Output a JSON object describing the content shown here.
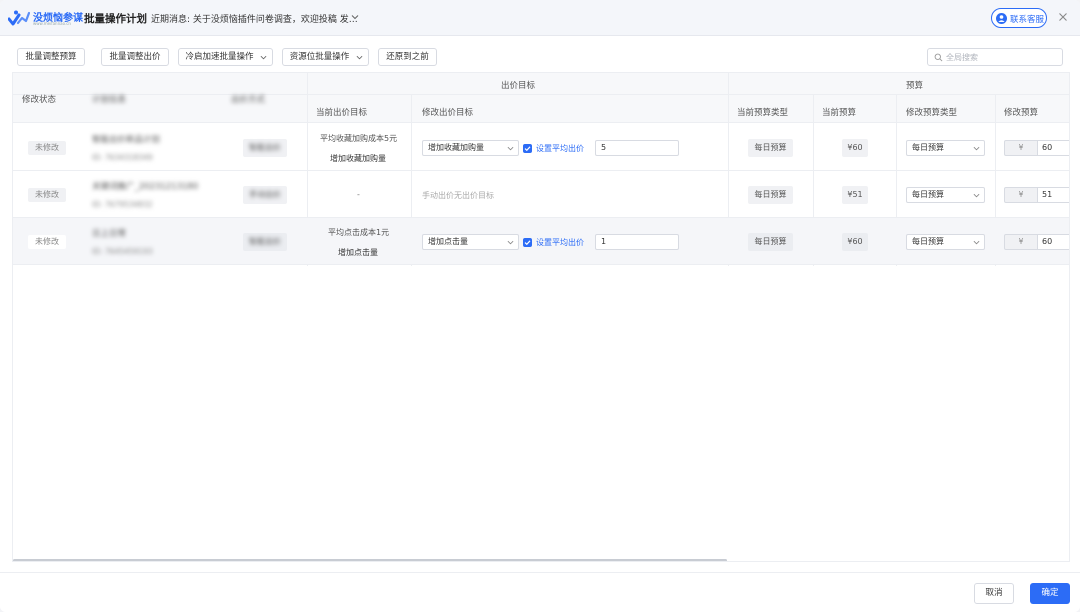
{
  "header": {
    "logo_text": "没烦恼参谋",
    "logo_sub": "www.meifannao.cn",
    "title": "批量操作计划",
    "news": "近期消息: 关于没烦恼插件问卷调查，欢迎投稿 发…",
    "support_label": "联系客服"
  },
  "toolbar": {
    "buttons": [
      "批量调整预算",
      "批量调整出价",
      "冷启加速批量操作",
      "资源位批量操作",
      "还原到之前"
    ],
    "search_placeholder": "全局搜索"
  },
  "table": {
    "group_headers": {
      "bid": "出价目标",
      "budget": "预算"
    },
    "headers": {
      "status": "修改状态",
      "plan": "计划信息",
      "mode": "出价方式",
      "current_bid_target": "当前出价目标",
      "modify_bid_target": "修改出价目标",
      "current_budget_type": "当前预算类型",
      "current_budget": "当前预算",
      "modify_budget_type": "修改预算类型",
      "modify_budget": "修改预算"
    },
    "rows": [
      {
        "status": "未修改",
        "plan_name": "智能出价新品计划",
        "plan_id": "ID: 7634318349",
        "mode": "智能出价",
        "current_target_line1": "平均收藏加购成本5元",
        "current_target_line2": "增加收藏加购量",
        "modify_select": "增加收藏加购量",
        "checkbox_label": "设置平均出价",
        "bid_value": "5",
        "current_budget_type": "每日预算",
        "current_budget": "¥60",
        "modify_budget_type": "每日预算",
        "yen": "¥",
        "budget_value": "60"
      },
      {
        "status": "未修改",
        "plan_name": "关键词推广_20231213180",
        "plan_id": "ID: 7679534832",
        "mode": "手动出价",
        "current_target_line1": "-",
        "manual_note": "手动出价无出价目标",
        "current_budget_type": "每日预算",
        "current_budget": "¥51",
        "modify_budget_type": "每日预算",
        "yen": "¥",
        "budget_value": "51"
      },
      {
        "status": "未修改",
        "plan_name": "日上日常",
        "plan_id": "ID: 7645459193",
        "mode": "智能出价",
        "current_target_line1": "平均点击成本1元",
        "current_target_line2": "增加点击量",
        "modify_select": "增加点击量",
        "checkbox_label": "设置平均出价",
        "bid_value": "1",
        "current_budget_type": "每日预算",
        "current_budget": "¥60",
        "modify_budget_type": "每日预算",
        "yen": "¥",
        "budget_value": "60"
      }
    ]
  },
  "footer": {
    "cancel": "取消",
    "ok": "确定"
  },
  "colors": {
    "accent": "#2c6cf6",
    "border": "#d8dbe2",
    "header_bg": "#f7f8fa"
  }
}
